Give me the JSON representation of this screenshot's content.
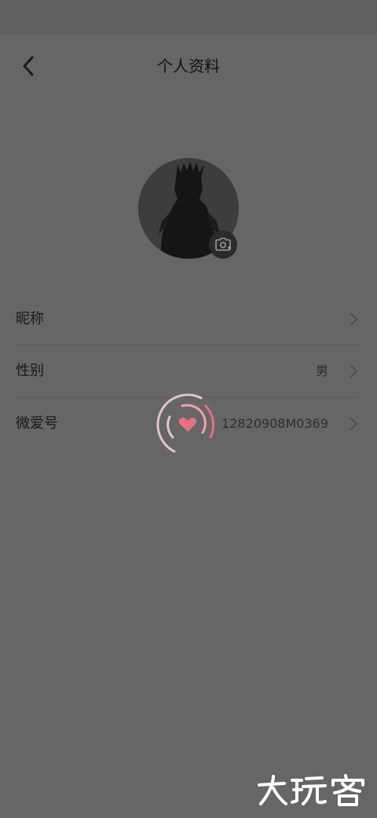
{
  "header": {
    "title": "个人资料",
    "back_icon": "chevron-left-icon"
  },
  "avatar": {
    "camera_icon": "camera-icon"
  },
  "rows": [
    {
      "label": "昵称",
      "value": ""
    },
    {
      "label": "性别",
      "value": "男"
    },
    {
      "label": "微爱号",
      "value": "12820908M0369"
    }
  ],
  "loading": {
    "icon": "heart-icon",
    "accent_color": "#e8707f"
  },
  "watermark": {
    "text": "大玩客"
  },
  "colors": {
    "overlay": "#666666",
    "title_text": "#111111",
    "row_text": "#1a1a1a"
  }
}
